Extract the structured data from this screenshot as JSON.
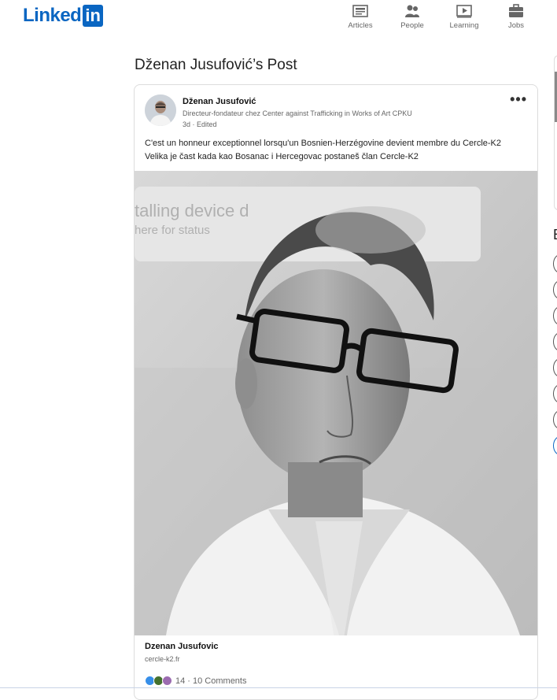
{
  "brand": {
    "logo_text": "Linked",
    "logo_box": "in"
  },
  "nav": {
    "items": [
      {
        "label": "Articles",
        "icon": "articles-icon"
      },
      {
        "label": "People",
        "icon": "people-icon"
      },
      {
        "label": "Learning",
        "icon": "learning-icon"
      },
      {
        "label": "Jobs",
        "icon": "jobs-icon"
      }
    ]
  },
  "page": {
    "title": "Dženan Jusufović’s Post"
  },
  "post": {
    "author_name": "Dženan Jusufović",
    "author_headline": "Directeur-fondateur chez Center against Trafficking in Works of Art CPKU",
    "meta": "3d · Edited",
    "more_label": "•••",
    "text_line1": "C'est un honneur exceptionnel lorsqu'un Bosnien-Herzégovine devient membre du Cercle-K2",
    "text_line2": "Velika je čast kada kao Bosanac i Hercegovac postaneš član Cercle-K2",
    "photo_overlay_line1": "talling device d",
    "photo_overlay_line2": "here for status",
    "link_title": "Dzenan Jusufovic",
    "link_domain": "cercle-k2.fr",
    "reactions": "14 · 10 Comments"
  },
  "sidebar_partial": {
    "heading_letter": "E"
  },
  "colors": {
    "brand": "#0a66c2",
    "like": "#378fe9",
    "celebrate": "#44712e",
    "love": "#df704d",
    "insightful": "#915907"
  }
}
